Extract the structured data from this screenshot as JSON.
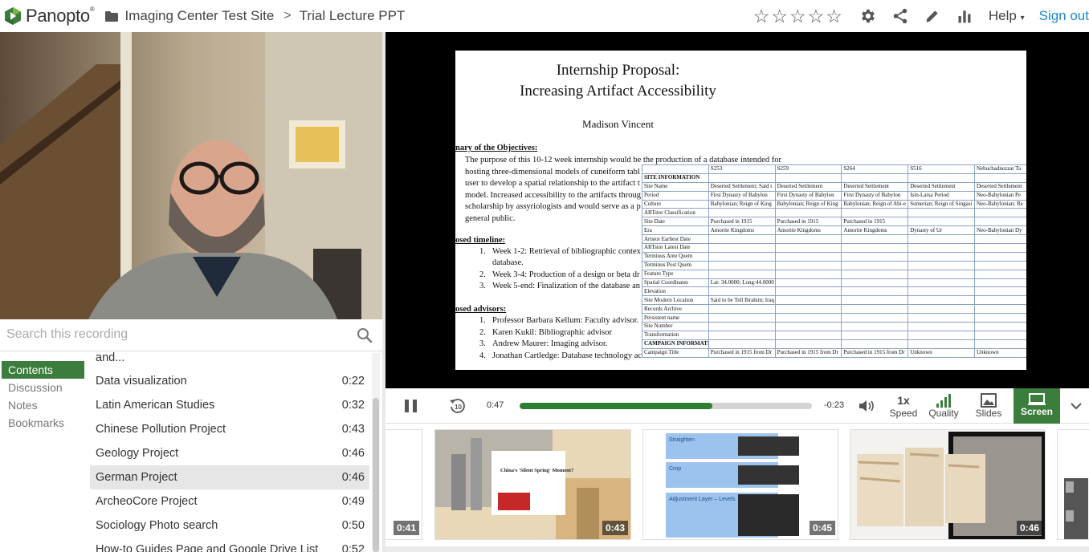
{
  "header": {
    "logo_text": "Panopto",
    "logo_tm": "®",
    "breadcrumb_folder": "Imaging Center Test Site",
    "breadcrumb_session": "Trial Lecture PPT",
    "help_label": "Help",
    "signout_label": "Sign out"
  },
  "search": {
    "placeholder": "Search this recording"
  },
  "sidenav": {
    "items": [
      "Contents",
      "Discussion",
      "Notes",
      "Bookmarks"
    ]
  },
  "contents": [
    {
      "title": "and...",
      "time": ""
    },
    {
      "title": "Data visualization",
      "time": "0:22"
    },
    {
      "title": "Latin American Studies",
      "time": "0:32"
    },
    {
      "title": "Chinese Pollution Project",
      "time": "0:43"
    },
    {
      "title": "Geology Project",
      "time": "0:46"
    },
    {
      "title": "German Project",
      "time": "0:46"
    },
    {
      "title": "ArcheoCore Project",
      "time": "0:49"
    },
    {
      "title": "Sociology Photo search",
      "time": "0:50"
    },
    {
      "title": "How-to Guides Page and Google Drive List",
      "time": "0:52"
    }
  ],
  "slide": {
    "title_line1": "Internship Proposal:",
    "title_line2": "Increasing Artifact Accessibility",
    "author": "Madison Vincent",
    "summary_heading": "nary of the Objectives:",
    "summary_lines": [
      "The purpose of this 10-12 week internship would be the production of a database intended for",
      "hosting three-dimensional models of cuneiform tabl",
      "user to develop a spatial relationship to the artifact t",
      "model. Increased accessibility to the artifacts throug",
      "scholarship by assyriologists and would serve as a p",
      "general public."
    ],
    "timeline_heading": "osed timeline:",
    "timeline": [
      {
        "n": "1.",
        "text": "Week 1-2: Retrieval of bibliographic contex"
      },
      {
        "n": "",
        "text": "database."
      },
      {
        "n": "2.",
        "text": "Week 3-4: Production of a design or beta dr"
      },
      {
        "n": "3.",
        "text": "Week 5-end: Finalization of the database an"
      }
    ],
    "advisors_heading": "osed advisors:",
    "advisors": [
      {
        "n": "1.",
        "text": "Professor Barbara Kellum: Faculty advisor."
      },
      {
        "n": "2.",
        "text": "Karen Kukil: Bibliographic advisor"
      },
      {
        "n": "3.",
        "text": "Andrew Maurer: Imaging advisor."
      },
      {
        "n": "4.",
        "text": "Jonathan Cartledge: Database technology ac"
      }
    ],
    "table_header": [
      "",
      "S253",
      "S259",
      "S264",
      "S516",
      "Nebuchadnezzar Ta"
    ],
    "table_rows": [
      [
        "SITE INFORMATION",
        "",
        "",
        "",
        "",
        ""
      ],
      [
        "Site Name",
        "Deserted Settlement; Said t",
        "Deserted Settlement",
        "Deserted Settlement",
        "Deserted Settlement",
        "Deserted Settlement"
      ],
      [
        "Period",
        "First Dynasty of Babylon",
        "First Dynasty of Babylon",
        "First Dynasty of Babylon",
        "Isin-Larsa Period",
        "Neo-Babylonian Pe"
      ],
      [
        "Culture",
        "Babylonian; Reign of King",
        "Babylonian; Reign of King",
        "Babylonian; Reign of Abi-e",
        "Sumerian; Reign of Singasi",
        "Neo-Babylonian; Re"
      ],
      [
        "ARTstor Classification",
        "",
        "",
        "",
        "",
        ""
      ],
      [
        "Site Date",
        "Purchased in 1915",
        "Purchased in 1915",
        "Purchased in 1915",
        "",
        ""
      ],
      [
        "Era",
        "Amorite Kingdoms",
        "Amorite Kingdoms",
        "Amorite Kingdoms",
        "Dynasty of Ur",
        "Neo-Babylonian Dy"
      ],
      [
        "Artstor Earliest Date",
        "",
        "",
        "",
        "",
        ""
      ],
      [
        "ARTstor Latest Date",
        "",
        "",
        "",
        "",
        ""
      ],
      [
        "Terminus Ante Quem",
        "",
        "",
        "",
        "",
        ""
      ],
      [
        "Terminus Post Quem",
        "",
        "",
        "",
        "",
        ""
      ],
      [
        "Feature Type",
        "",
        "",
        "",
        "",
        ""
      ],
      [
        "Spatial Coordinates",
        "Lat: 34.0000; Long:44.0000",
        "",
        "",
        "",
        ""
      ],
      [
        "Elevation",
        "",
        "",
        "",
        "",
        ""
      ],
      [
        "Site Modern Location",
        "Said to be Tell Ibrahim; Iraq",
        "",
        "",
        "",
        ""
      ],
      [
        "Records Archive",
        "",
        "",
        "",
        "",
        ""
      ],
      [
        "Persistent name",
        "",
        "",
        "",
        "",
        ""
      ],
      [
        "Site Number",
        "",
        "",
        "",
        "",
        ""
      ],
      [
        "Transformation",
        "",
        "",
        "",
        "",
        ""
      ],
      [
        "CAMPAIGN INFORMATION",
        "",
        "",
        "",
        "",
        ""
      ],
      [
        "Campaign Title",
        "Purchased in 1915 from Dr",
        "Purchased in 1915 from Dr",
        "Purchased in 1915 from Dr",
        "Unknown",
        "Unknown"
      ]
    ]
  },
  "player": {
    "current_time": "0:47",
    "remaining_time": "-0:23",
    "progress_fraction": 0.66,
    "speed_value": "1x",
    "speed_label": "Speed",
    "quality_label": "Quality",
    "slides_label": "Slides",
    "screen_label": "Screen",
    "accent_color": "#3b7d3c"
  },
  "thumbnails": [
    {
      "time": "0:41"
    },
    {
      "time": "0:43",
      "headline": "China's 'Silent Spring' Moment?"
    },
    {
      "time": "0:45",
      "labels": [
        "Straighten",
        "Crop",
        "Adjustment Layer – Levels"
      ]
    },
    {
      "time": "0:46"
    }
  ]
}
